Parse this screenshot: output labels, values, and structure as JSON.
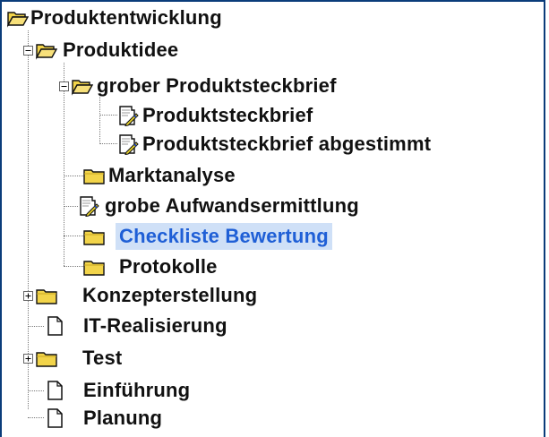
{
  "tree": {
    "root": {
      "label": "Produktentwicklung",
      "icon": "folder-open-icon"
    },
    "items": [
      {
        "label": "Produktidee",
        "icon": "folder-open-icon",
        "toggle": "minus"
      },
      {
        "label": "grober Produktsteckbrief",
        "icon": "folder-open-icon",
        "toggle": "minus"
      },
      {
        "label": "Produktsteckbrief",
        "icon": "document-edit-icon"
      },
      {
        "label": "Produktsteckbrief abgestimmt",
        "icon": "document-edit-icon"
      },
      {
        "label": "Marktanalyse",
        "icon": "folder-icon"
      },
      {
        "label": "grobe Aufwandsermittlung",
        "icon": "document-edit-icon"
      },
      {
        "label": "Checkliste Bewertung",
        "icon": "folder-icon",
        "selected": true
      },
      {
        "label": "Protokolle",
        "icon": "folder-icon"
      },
      {
        "label": "Konzepterstellung",
        "icon": "folder-icon",
        "toggle": "plus"
      },
      {
        "label": "IT-Realisierung",
        "icon": "document-icon"
      },
      {
        "label": "Test",
        "icon": "folder-icon",
        "toggle": "plus"
      },
      {
        "label": "Einführung",
        "icon": "document-icon"
      },
      {
        "label": "Planung",
        "icon": "document-icon"
      }
    ]
  },
  "colors": {
    "frame": "#0a3c7a",
    "selection_bg": "#cfe0f7",
    "selection_text": "#1f5fd6",
    "folder": "#f2d44a"
  }
}
